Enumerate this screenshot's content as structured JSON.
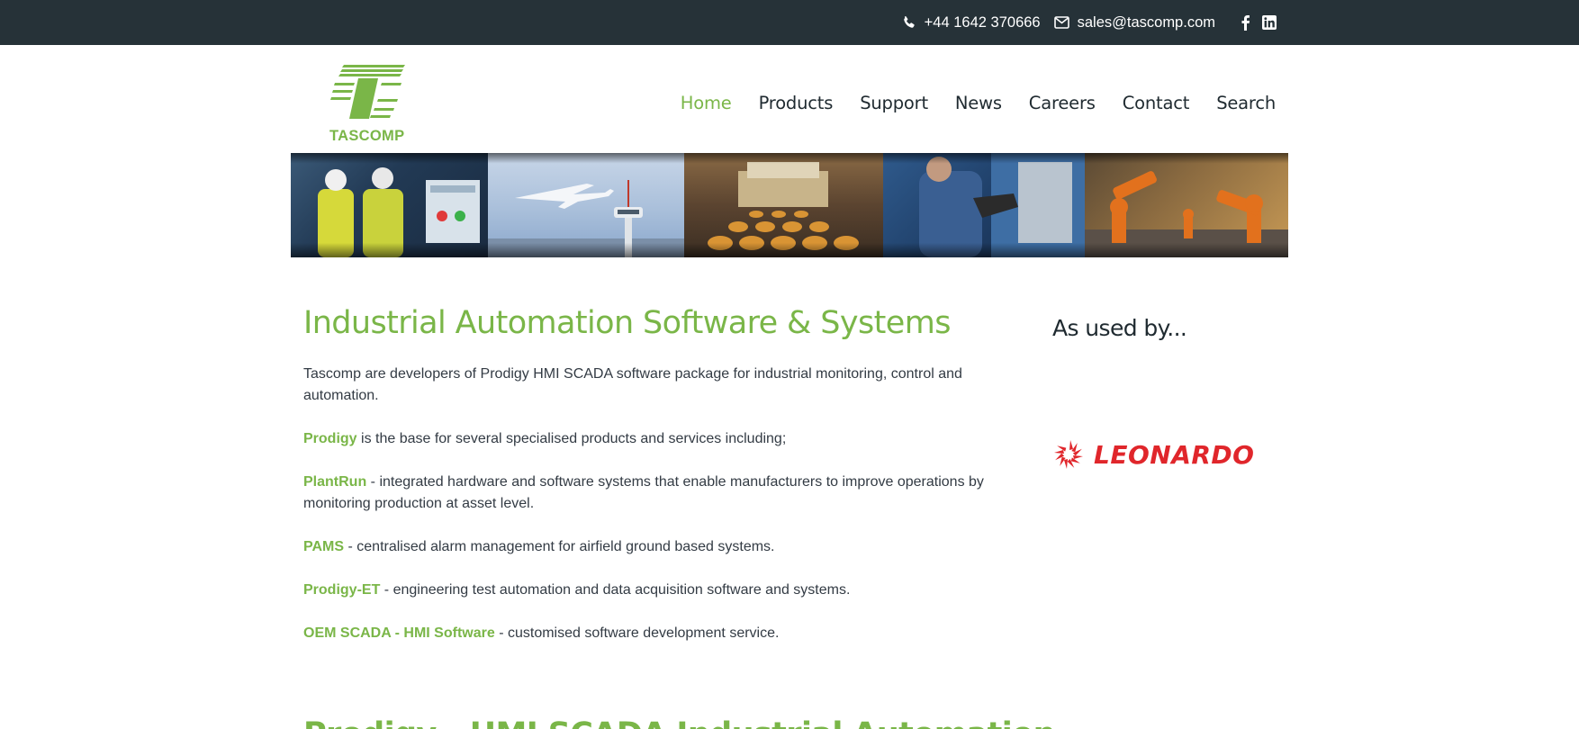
{
  "topbar": {
    "phone": "+44 1642 370666",
    "email": "sales@tascomp.com",
    "icons": [
      "phone-icon",
      "mail-icon",
      "facebook-icon",
      "linkedin-icon"
    ]
  },
  "header": {
    "logo_text": "TASCOMP",
    "nav": [
      {
        "label": "Home",
        "active": true
      },
      {
        "label": "Products"
      },
      {
        "label": "Support"
      },
      {
        "label": "News"
      },
      {
        "label": "Careers"
      },
      {
        "label": "Contact"
      },
      {
        "label": "Search"
      }
    ]
  },
  "main": {
    "title": "Industrial Automation Software & Systems",
    "intro": "Tascomp are developers of Prodigy HMI SCADA software package for industrial monitoring, control and automation.",
    "items": [
      {
        "link": "Prodigy",
        "text": " is the base for several specialised products and services including;"
      },
      {
        "link": "PlantRun",
        "text": " - integrated hardware and software systems that enable manufacturers to improve operations by monitoring production at asset level."
      },
      {
        "link": "PAMS",
        "text": " - centralised alarm management for airfield ground based systems."
      },
      {
        "link": "Prodigy-ET",
        "text": " - engineering test automation and data acquisition software and systems."
      },
      {
        "link": "OEM SCADA - HMI Software",
        "text": " - customised software development service."
      }
    ],
    "next_title": "Prodigy - HMI SCADA Industrial Automation"
  },
  "sidebar": {
    "title": "As used by...",
    "client": "LEONARDO"
  },
  "colors": {
    "accent": "#7ab648",
    "topbar_bg": "#263238",
    "client_red": "#e0262b"
  }
}
